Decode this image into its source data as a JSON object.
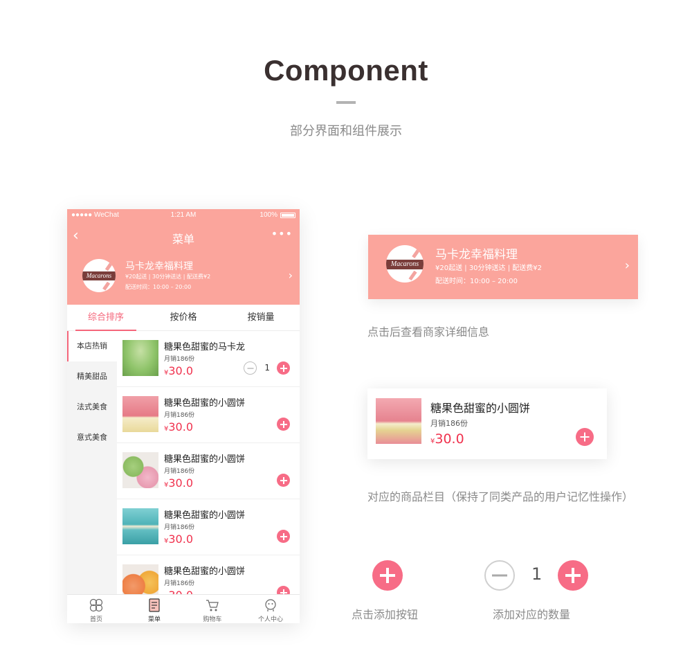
{
  "header": {
    "title": "Component",
    "subtitle": "部分界面和组件展示"
  },
  "phone": {
    "status": {
      "carrier": "●●●●● WeChat",
      "time": "1:21 AM",
      "battery": "100%"
    },
    "nav": {
      "back_icon": "‹",
      "title": "菜单",
      "more_icon": "•••"
    },
    "shop": {
      "logo_text": "Macarons",
      "name": "马卡龙幸福料理",
      "meta": "¥20起送 | 30分钟送达 | 配送费¥2",
      "delivery": "配送时间：10:00 – 20:00",
      "arrow": "›"
    },
    "sort_tabs": [
      "综合排序",
      "按价格",
      "按销量"
    ],
    "categories": [
      "本店热销",
      "精美甜品",
      "法式美食",
      "意式美食"
    ],
    "items": [
      {
        "name": "糖果色甜蜜的马卡龙",
        "sales": "月销186份",
        "currency": "¥",
        "price": "30.0",
        "qty": "1"
      },
      {
        "name": "糖果色甜蜜的小圆饼",
        "sales": "月销186份",
        "currency": "¥",
        "price": "30.0"
      },
      {
        "name": "糖果色甜蜜的小圆饼",
        "sales": "月销186份",
        "currency": "¥",
        "price": "30.0"
      },
      {
        "name": "糖果色甜蜜的小圆饼",
        "sales": "月销186份",
        "currency": "¥",
        "price": "30.0"
      },
      {
        "name": "糖果色甜蜜的小圆饼",
        "sales": "月销186份",
        "currency": "¥",
        "price": "30.0"
      }
    ],
    "tabbar": [
      "首页",
      "菜单",
      "购物车",
      "个人中心"
    ]
  },
  "showcase": {
    "shop_card": {
      "logo_text": "Macarons",
      "name": "马卡龙幸福料理",
      "meta": "¥20起送 | 30分钟送达 | 配送费¥2",
      "delivery": "配送时间：10:00 – 20:00",
      "arrow": "›"
    },
    "shop_caption": "点击后查看商家详细信息",
    "item_card": {
      "name": "糖果色甜蜜的小圆饼",
      "sales": "月销186份",
      "currency": "¥",
      "price": "30.0"
    },
    "item_caption": "对应的商品栏目（保持了同类产品的用户记忆性操作）",
    "add_caption": "点击添加按钮",
    "stepper_value": "1",
    "stepper_caption": "添加对应的数量"
  },
  "colors": {
    "brand_pink": "#fba59c",
    "accent": "#f76c86",
    "price_red": "#f0324e",
    "logo_brown": "#7a3d3a"
  }
}
